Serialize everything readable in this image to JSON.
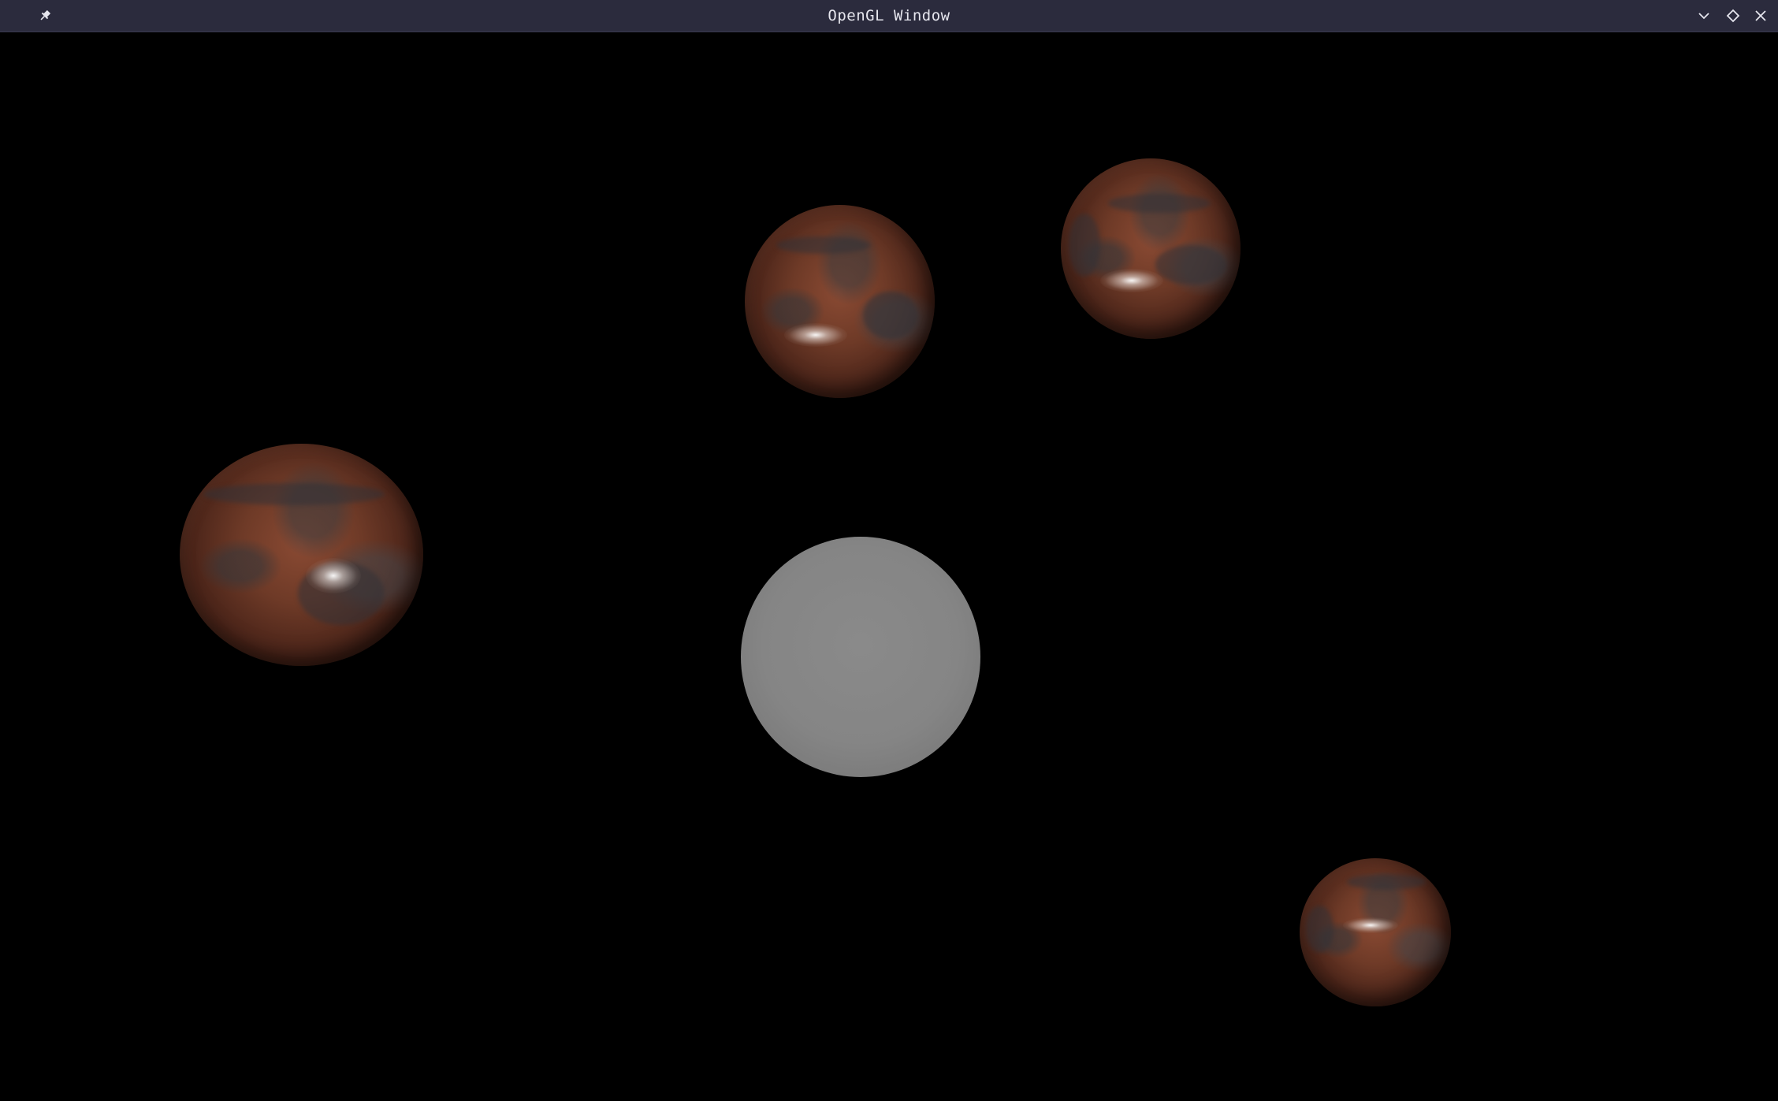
{
  "window": {
    "title": "OpenGL Window"
  },
  "titlebar": {
    "background": "#2b2b3d",
    "text_color": "#e6e6ee",
    "buttons": [
      {
        "name": "pin",
        "icon": "pin-icon"
      },
      {
        "name": "minimize",
        "icon": "chevron-down-icon"
      },
      {
        "name": "maximize",
        "icon": "diamond-icon"
      },
      {
        "name": "close",
        "icon": "close-icon"
      }
    ]
  },
  "scene": {
    "background": "#000000",
    "light_sphere_color": "#858585",
    "planet_base_color": "#6e3a27",
    "planet_count": 4
  }
}
